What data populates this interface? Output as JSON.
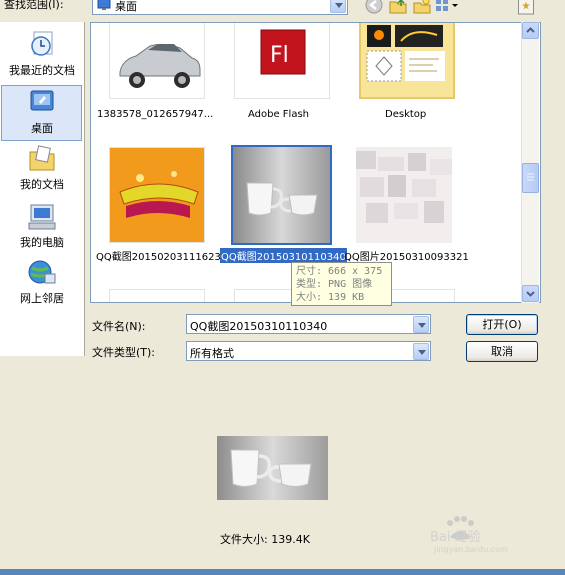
{
  "toolbar": {
    "lookin_label": "查找范围(I):",
    "lookin_value": "桌面",
    "icons": [
      "back-icon",
      "up-folder-icon",
      "new-folder-icon",
      "views-menu-icon"
    ]
  },
  "places": [
    {
      "label": "我最近的文档",
      "icon": "recent-documents-icon"
    },
    {
      "label": "桌面",
      "icon": "desktop-icon",
      "selected": true
    },
    {
      "label": "我的文档",
      "icon": "my-documents-icon"
    },
    {
      "label": "我的电脑",
      "icon": "my-computer-icon"
    },
    {
      "label": "网上邻居",
      "icon": "network-places-icon"
    }
  ],
  "files": [
    {
      "name": "1383578_012657947...",
      "thumb": "car"
    },
    {
      "name": "Adobe Flash",
      "thumb": "flash-logo"
    },
    {
      "name": "Desktop",
      "thumb": "desktop-folder"
    },
    {
      "name": "QQ截图20150203111623",
      "thumb": "orange-graphic"
    },
    {
      "name": "QQ截图20150310110340",
      "thumb": "cups",
      "selected": true
    },
    {
      "name": "QQ图片20150310093321",
      "thumb": "blurred"
    }
  ],
  "tooltip": {
    "size": "尺寸: 666 x 375",
    "type": "类型: PNG 图像",
    "filesize": "大小: 139 KB"
  },
  "form": {
    "filename_label": "文件名(N):",
    "filename_value": "QQ截图20150310110340",
    "filetype_label": "文件类型(T):",
    "filetype_value": "所有格式",
    "open_button": "打开(O)",
    "cancel_button": "取消"
  },
  "preview": {
    "file_size_text": "文件大小: 139.4K"
  },
  "watermark": {
    "text": "Bai 经验",
    "url": "jingyan.baidu.com"
  },
  "colors": {
    "selection": "#316ac5",
    "dialog_bg": "#ece9d8",
    "tooltip_bg": "#ffffe1"
  }
}
